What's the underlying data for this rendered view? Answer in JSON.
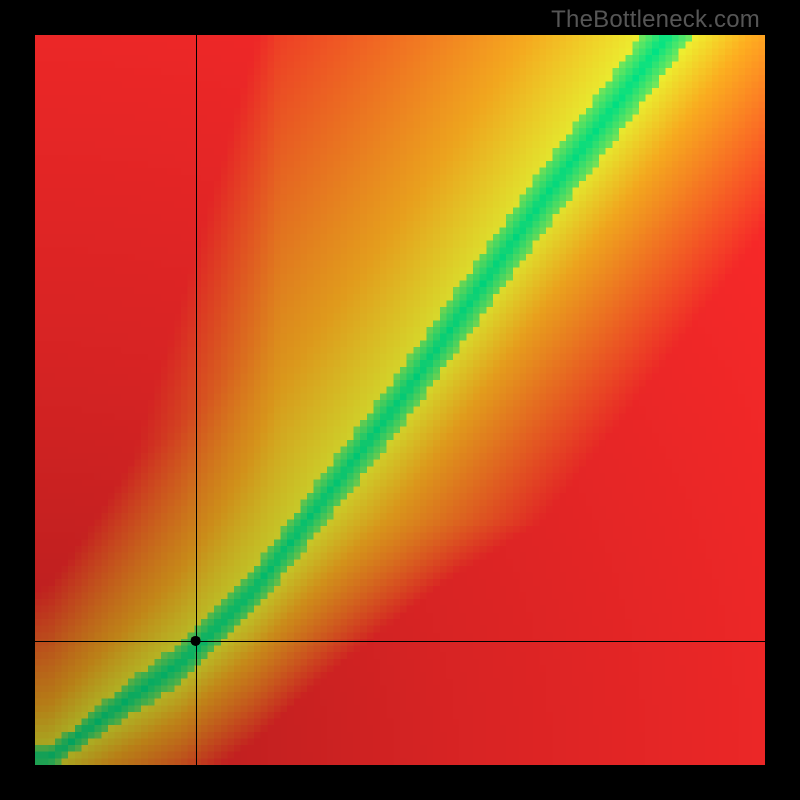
{
  "watermark": "TheBottleneck.com",
  "chart_data": {
    "type": "heatmap",
    "title": "",
    "xlabel": "",
    "ylabel": "",
    "xlim": [
      0,
      100
    ],
    "ylim": [
      0,
      100
    ],
    "grid": false,
    "legend": false,
    "resolution": 110,
    "crosshair": {
      "x": 22,
      "y": 17
    },
    "sweet_curve": {
      "comment": "y-value of the green sweet-spot diagonal as a function of x (percent of axis), estimated from pixels",
      "x": [
        2,
        10,
        20,
        30,
        40,
        50,
        60,
        70,
        80,
        100
      ],
      "y": [
        1,
        7,
        14,
        24,
        37,
        50,
        64,
        78,
        91,
        118
      ]
    },
    "band_halfwidth": {
      "comment": "half-width of the green band (in percent of axis) as a function of x",
      "x": [
        2,
        15,
        30,
        50,
        70,
        100
      ],
      "w": [
        1.5,
        2.5,
        3.0,
        4.0,
        4.5,
        5.0
      ]
    },
    "brightness": {
      "comment": "radial luminance ramp toward top-right corner (0=origin, 1=far corner)",
      "r": [
        0.0,
        0.4,
        1.0
      ],
      "v": [
        0.3,
        0.65,
        1.0
      ]
    },
    "colors": {
      "best": "#00e787",
      "good": "#f2f230",
      "mid": "#ffb020",
      "bad": "#ff2a2a",
      "cross": "#000000",
      "dot": "#000000"
    }
  }
}
